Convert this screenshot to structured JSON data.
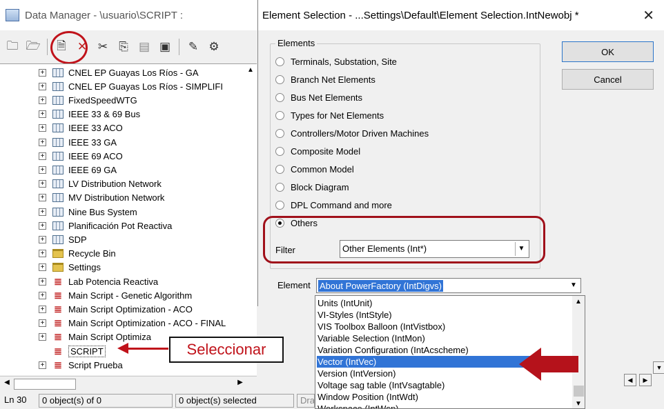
{
  "data_manager": {
    "title": "Data Manager - \\usuario\\SCRIPT :",
    "toolbar_icons": [
      "folder-up-icon",
      "folder-open-icon",
      "new-object-icon",
      "delete-icon",
      "cut-icon",
      "copy-icon",
      "paste-icon",
      "paste-special-icon",
      "edit-icon",
      "tools-icon"
    ],
    "tree_items": [
      {
        "label": "CNEL EP Guayas Los Ríos - GA",
        "icon": "grid-icon"
      },
      {
        "label": "CNEL EP Guayas Los Ríos - SIMPLIFI",
        "icon": "grid-icon"
      },
      {
        "label": "FixedSpeedWTG",
        "icon": "grid-icon"
      },
      {
        "label": "IEEE 33 & 69 Bus",
        "icon": "grid-icon"
      },
      {
        "label": "IEEE 33 ACO",
        "icon": "grid-icon"
      },
      {
        "label": "IEEE 33 GA",
        "icon": "grid-icon"
      },
      {
        "label": "IEEE 69 ACO",
        "icon": "grid-icon"
      },
      {
        "label": "IEEE 69 GA",
        "icon": "grid-icon"
      },
      {
        "label": "LV Distribution Network",
        "icon": "grid-icon"
      },
      {
        "label": "MV Distribution Network",
        "icon": "grid-icon"
      },
      {
        "label": "Nine Bus System",
        "icon": "grid-icon"
      },
      {
        "label": "Planificación Pot Reactiva",
        "icon": "grid-icon"
      },
      {
        "label": "SDP",
        "icon": "grid-icon"
      },
      {
        "label": "Recycle Bin",
        "icon": "folder-icon"
      },
      {
        "label": "Settings",
        "icon": "folder-icon"
      },
      {
        "label": "Lab Potencia Reactiva",
        "icon": "script-icon"
      },
      {
        "label": "Main Script - Genetic Algorithm",
        "icon": "script-icon"
      },
      {
        "label": "Main Script Optimization - ACO",
        "icon": "script-icon"
      },
      {
        "label": "Main Script Optimization - ACO - FINAL",
        "icon": "script-icon"
      },
      {
        "label": "Main Script Optimiza",
        "icon": "script-icon"
      },
      {
        "label": "SCRIPT",
        "icon": "script-icon"
      },
      {
        "label": "Script Prueba",
        "icon": "script-icon"
      }
    ],
    "annotation": "Seleccionar",
    "status": {
      "line": "Ln 30",
      "objects": "0 object(s) of 0",
      "selected": "0 object(s) selected",
      "extra": "Dra"
    }
  },
  "dialog": {
    "title": "Element Selection - ...Settings\\Default\\Element Selection.IntNewobj *",
    "group_label": "Elements",
    "radios": [
      {
        "label": "Terminals, Substation, Site",
        "checked": false
      },
      {
        "label": "Branch Net Elements",
        "checked": false
      },
      {
        "label": "Bus Net Elements",
        "checked": false
      },
      {
        "label": "Types for Net Elements",
        "checked": false
      },
      {
        "label": "Controllers/Motor Driven Machines",
        "checked": false
      },
      {
        "label": "Composite Model",
        "checked": false
      },
      {
        "label": "Common Model",
        "checked": false
      },
      {
        "label": "Block Diagram",
        "checked": false
      },
      {
        "label": "DPL Command and more",
        "checked": false
      },
      {
        "label": "Others",
        "checked": true
      }
    ],
    "filter_label": "Filter",
    "filter_value": "Other Elements (Int*)",
    "element_label": "Element",
    "element_value": "About PowerFactory (IntDigvs)",
    "ok_label": "OK",
    "cancel_label": "Cancel",
    "dropdown_items": [
      "Units (IntUnit)",
      "VI-Styles (IntStyle)",
      "VIS Toolbox Balloon (IntVistbox)",
      "Variable Selection (IntMon)",
      "Variation Configuration (IntAcscheme)",
      "Vector (IntVec)",
      "Version (IntVersion)",
      "Voltage sag table (IntVsagtable)",
      "Window Position (IntWdt)",
      "Workspace (IntWsp)"
    ],
    "dropdown_selected": "Vector (IntVec)"
  },
  "colors": {
    "highlight_red": "#c0121a",
    "selection_blue": "#3174d6"
  }
}
